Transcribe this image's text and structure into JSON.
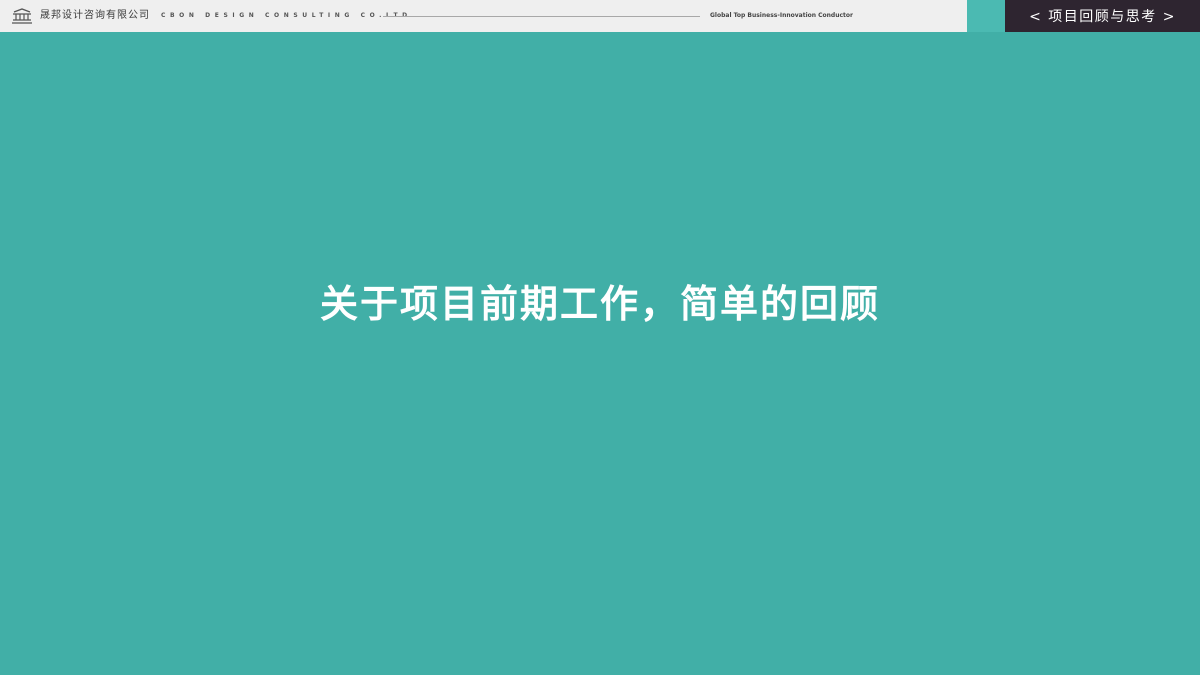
{
  "colors": {
    "background": "#41afa7",
    "header_background": "#efefef",
    "accent_block": "#4bbab2",
    "section_tab_background": "#2e2530",
    "title_text": "#ffffff"
  },
  "header": {
    "logo_icon": "pavilion-logo-icon",
    "company_name_cn": "晟邦设计咨询有限公司",
    "company_name_en": "CBON DESIGN CONSULTING CO.LTD",
    "slogan": "Global Top Business-Innovation Conductor",
    "section_tab": "< 项目回顾与思考 >"
  },
  "main": {
    "title": "关于项目前期工作，简单的回顾"
  }
}
